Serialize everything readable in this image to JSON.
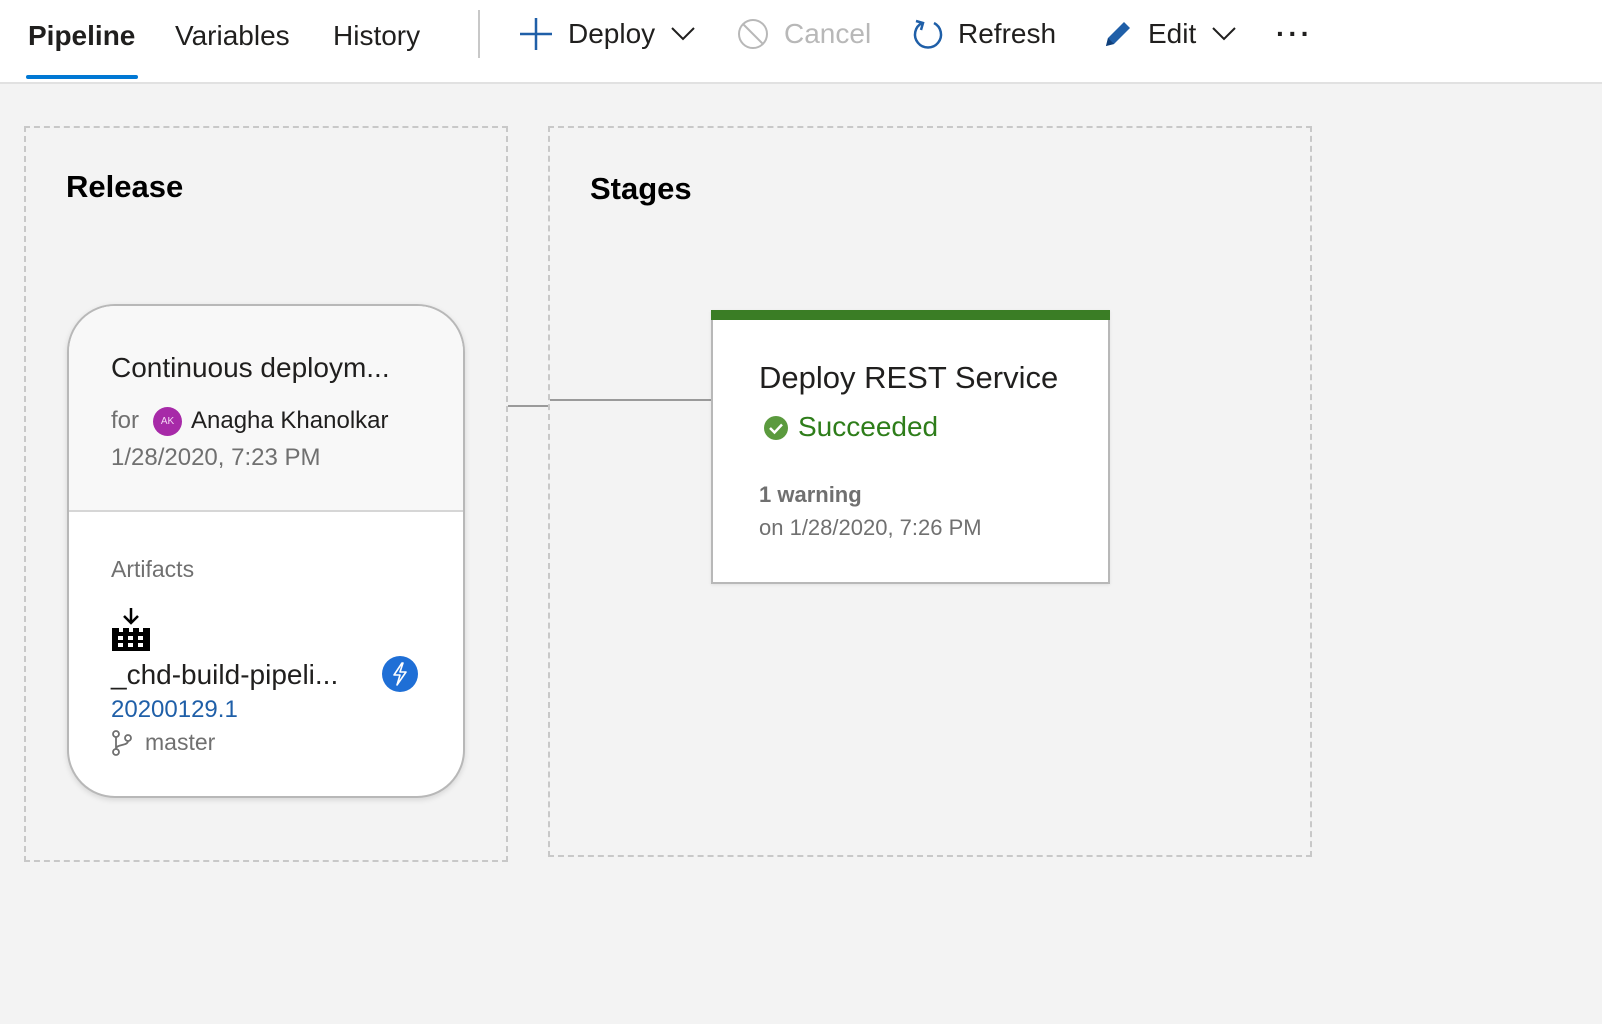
{
  "tabs": [
    {
      "label": "Pipeline",
      "active": true
    },
    {
      "label": "Variables",
      "active": false
    },
    {
      "label": "History",
      "active": false
    }
  ],
  "toolbar": {
    "deploy": "Deploy",
    "cancel": "Cancel",
    "refresh": "Refresh",
    "edit": "Edit",
    "more": "···"
  },
  "release": {
    "heading": "Release",
    "title": "Continuous deploym...",
    "for_label": "for",
    "avatar_initials": "AK",
    "user": "Anagha Khanolkar",
    "date": "1/28/2020, 7:23 PM",
    "artifacts_label": "Artifacts",
    "artifact_name": "_chd-build-pipeli...",
    "artifact_version": "20200129.1",
    "branch": "master"
  },
  "stages": {
    "heading": "Stages",
    "items": [
      {
        "name": "Deploy REST Service",
        "status": "Succeeded",
        "warnings": "1 warning",
        "completed": "on 1/28/2020, 7:26 PM"
      }
    ]
  },
  "colors": {
    "accent": "#0078d4",
    "success": "#3a7d25",
    "avatar": "#a72aa8",
    "link": "#1f5fa8"
  },
  "icons": {
    "deploy": "plus-icon",
    "cancel": "cancel-icon",
    "refresh": "refresh-icon",
    "edit": "pencil-icon",
    "artifact": "build-artifact-icon",
    "trigger": "lightning-icon",
    "branch": "branch-icon",
    "status": "check-circle-icon"
  }
}
